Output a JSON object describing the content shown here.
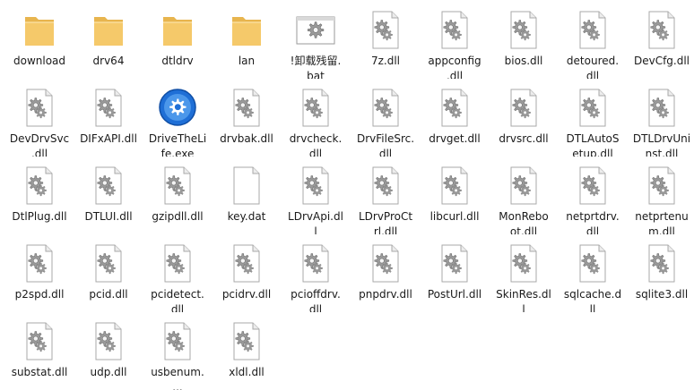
{
  "files": [
    {
      "name": "download",
      "type": "folder"
    },
    {
      "name": "drv64",
      "type": "folder"
    },
    {
      "name": "dtldrv",
      "type": "folder"
    },
    {
      "name": "lan",
      "type": "folder"
    },
    {
      "name": "!卸载残留.\nbat",
      "type": "bat"
    },
    {
      "name": "7z.dll",
      "type": "dll"
    },
    {
      "name": "appconfig\n.dll",
      "type": "dll"
    },
    {
      "name": "bios.dll",
      "type": "dll"
    },
    {
      "name": "detoured.\ndll",
      "type": "dll"
    },
    {
      "name": "DevCfg.dll",
      "type": "dll"
    },
    {
      "name": "DevDrvSvc\n.dll",
      "type": "dll"
    },
    {
      "name": "DIFxAPI.dll",
      "type": "dll"
    },
    {
      "name": "DriveTheLi\nfe.exe",
      "type": "exe"
    },
    {
      "name": "drvbak.dll",
      "type": "dll"
    },
    {
      "name": "drvcheck.\ndll",
      "type": "dll"
    },
    {
      "name": "DrvFileSrc.\ndll",
      "type": "dll"
    },
    {
      "name": "drvget.dll",
      "type": "dll"
    },
    {
      "name": "drvsrc.dll",
      "type": "dll"
    },
    {
      "name": "DTLAutoS\netup.dll",
      "type": "dll"
    },
    {
      "name": "DTLDrvUni\nnst.dll",
      "type": "dll"
    },
    {
      "name": "DtlPlug.dll",
      "type": "dll"
    },
    {
      "name": "DTLUI.dll",
      "type": "dll"
    },
    {
      "name": "gzipdll.dll",
      "type": "dll"
    },
    {
      "name": "key.dat",
      "type": "blank"
    },
    {
      "name": "LDrvApi.dl\nl",
      "type": "dll"
    },
    {
      "name": "LDrvProCt\nrl.dll",
      "type": "dll"
    },
    {
      "name": "libcurl.dll",
      "type": "dll"
    },
    {
      "name": "MonRebo\not.dll",
      "type": "dll"
    },
    {
      "name": "netprtdrv.\ndll",
      "type": "dll"
    },
    {
      "name": "netprtenu\nm.dll",
      "type": "dll"
    },
    {
      "name": "p2spd.dll",
      "type": "dll"
    },
    {
      "name": "pcid.dll",
      "type": "dll"
    },
    {
      "name": "pcidetect.\ndll",
      "type": "dll"
    },
    {
      "name": "pcidrv.dll",
      "type": "dll"
    },
    {
      "name": "pcioffdrv.\ndll",
      "type": "dll"
    },
    {
      "name": "pnpdrv.dll",
      "type": "dll"
    },
    {
      "name": "PostUrl.dll",
      "type": "dll"
    },
    {
      "name": "SkinRes.dl\nl",
      "type": "dll"
    },
    {
      "name": "sqlcache.d\nll",
      "type": "dll"
    },
    {
      "name": "sqlite3.dll",
      "type": "dll"
    },
    {
      "name": "substat.dll",
      "type": "dll"
    },
    {
      "name": "udp.dll",
      "type": "dll"
    },
    {
      "name": "usbenum.\n...",
      "type": "dll"
    },
    {
      "name": "xldl.dll",
      "type": "dll"
    }
  ],
  "icons": {
    "folder": "folder-icon",
    "dll": "dll-file-icon",
    "bat": "batch-file-icon",
    "exe": "drivethelife-app-icon",
    "blank": "blank-file-icon"
  },
  "colors": {
    "folder": "#f5c96a",
    "gear": "#8a8a8a",
    "app_blue": "#1f6fd6",
    "text": "#1a1a1a"
  }
}
